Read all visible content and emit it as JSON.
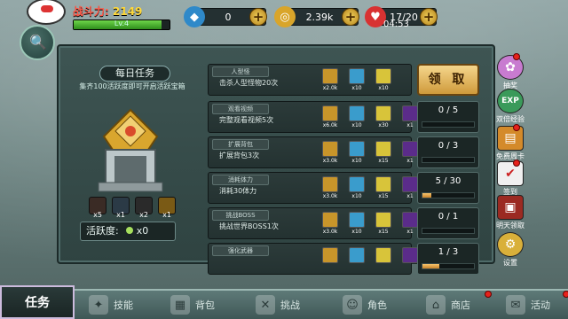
{
  "header": {
    "power_label": "战斗力:",
    "power_value": "2149",
    "level": "Lv.4",
    "level_fill": 0.92
  },
  "resources": [
    {
      "icon": "diamond-icon",
      "value": "0"
    },
    {
      "icon": "gold-coin-icon",
      "value": "2.39k"
    },
    {
      "icon": "heart-icon",
      "value": "17/20"
    }
  ],
  "timer": "04:53",
  "daily": {
    "title": "每日任务",
    "hint": "集齐100活跃度即可开启活跃宝箱",
    "activity_label": "活跃度:",
    "activity_value": "x0",
    "rewards": [
      {
        "icon": "flame-icon",
        "count": "x5"
      },
      {
        "icon": "scroll-icon",
        "count": "x1"
      },
      {
        "icon": "card-icon",
        "count": "x2"
      },
      {
        "icon": "coin-icon",
        "count": "x1"
      }
    ]
  },
  "tasks": [
    {
      "tag": "人型怪",
      "desc": "击杀人型怪物20次",
      "items": [
        {
          "icon": "coin-icon",
          "count": "x2.0k"
        },
        {
          "icon": "gem-icon",
          "count": "x10"
        },
        {
          "icon": "star-icon",
          "count": "x10"
        }
      ],
      "claim": "领 取"
    },
    {
      "tag": "观看视频",
      "desc": "完整观看视频5次",
      "items": [
        {
          "icon": "coin-icon",
          "count": "x6.0k"
        },
        {
          "icon": "gem-icon",
          "count": "x10"
        },
        {
          "icon": "star-icon",
          "count": "x30"
        },
        {
          "icon": "sword-icon",
          "count": "x1"
        }
      ],
      "progress": "0 / 5",
      "fill": 0
    },
    {
      "tag": "扩展背包",
      "desc": "扩展背包3次",
      "items": [
        {
          "icon": "coin-icon",
          "count": "x3.0k"
        },
        {
          "icon": "gem-icon",
          "count": "x10"
        },
        {
          "icon": "star-icon",
          "count": "x15"
        },
        {
          "icon": "sword-icon",
          "count": "x1"
        }
      ],
      "progress": "0 / 3",
      "fill": 0
    },
    {
      "tag": "消耗体力",
      "desc": "消耗30体力",
      "items": [
        {
          "icon": "coin-icon",
          "count": "x3.0k"
        },
        {
          "icon": "gem-icon",
          "count": "x10"
        },
        {
          "icon": "star-icon",
          "count": "x15"
        },
        {
          "icon": "sword-icon",
          "count": "x1"
        }
      ],
      "progress": "5 / 30",
      "fill": 0.17
    },
    {
      "tag": "挑战BOSS",
      "desc": "挑战世界BOSS1次",
      "items": [
        {
          "icon": "coin-icon",
          "count": "x3.0k"
        },
        {
          "icon": "gem-icon",
          "count": "x10"
        },
        {
          "icon": "star-icon",
          "count": "x15"
        },
        {
          "icon": "sword-icon",
          "count": "x1"
        }
      ],
      "progress": "0 / 1",
      "fill": 0
    },
    {
      "tag": "强化武器",
      "desc": "",
      "items": [
        {
          "icon": "coin-icon",
          "count": ""
        },
        {
          "icon": "gem-icon",
          "count": ""
        },
        {
          "icon": "star-icon",
          "count": ""
        },
        {
          "icon": "sword-icon",
          "count": ""
        }
      ],
      "progress": "1 / 3",
      "fill": 0.33
    }
  ],
  "right_menu": [
    "抽奖",
    "双倍经验",
    "免费周卡",
    "签到",
    "明天领取",
    "设置"
  ],
  "right_exp_badge": "EXP",
  "nav": {
    "current": "任务",
    "tabs": [
      "技能",
      "背包",
      "挑战",
      "角色",
      "商店",
      "活动"
    ]
  }
}
